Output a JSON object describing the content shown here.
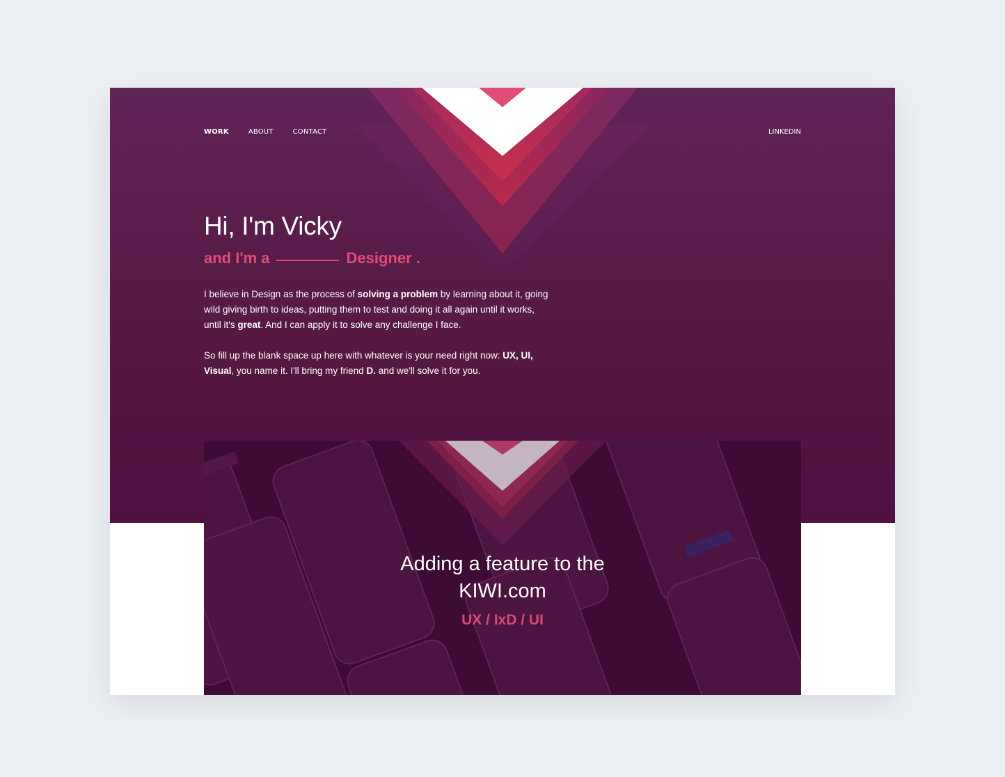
{
  "nav": {
    "items": [
      {
        "label": "WORK",
        "active": true
      },
      {
        "label": "ABOUT",
        "active": false
      },
      {
        "label": "CONTACT",
        "active": false
      }
    ],
    "right_link": "LINKEDIN"
  },
  "hero": {
    "title": "Hi, I'm Vicky",
    "subtitle_prefix": "and I'm a",
    "subtitle_suffix": "Designer .",
    "p1": {
      "t1": "I believe in Design as the process of ",
      "b1": "solving a problem",
      "t2": " by learning about it, going wild giving birth to ideas, putting them to test and doing it all again until it works, until it's ",
      "b2": "great",
      "t3": ". And I can apply it to solve any challenge I face."
    },
    "p2": {
      "t1": "So fill up the blank space up here with whatever is your need right now:  ",
      "b1": "UX, UI, Visual",
      "t2": ", you name it. I'll bring my friend ",
      "b2": "D.",
      "t3": " and we'll solve it for you."
    }
  },
  "project": {
    "title_line1": "Adding a feature to the",
    "title_line2": "KIWI.com",
    "tags": "UX / IxD / UI"
  },
  "colors": {
    "page_bg": "#edf0f3",
    "hero_bg": "#5a1d50",
    "accent_pink": "#e04b77",
    "card_bg": "#3e0b33"
  }
}
